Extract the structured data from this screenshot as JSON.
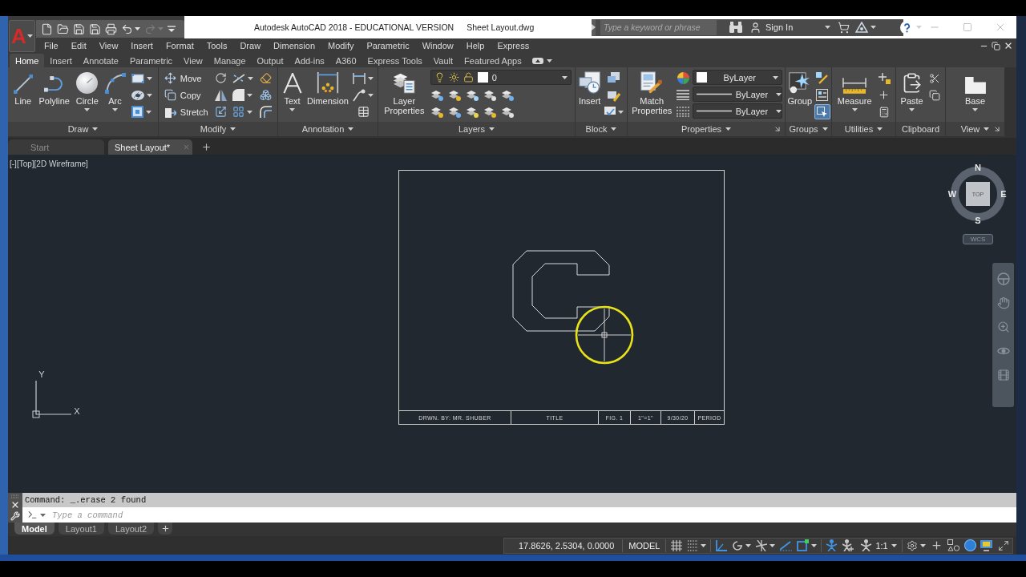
{
  "app_button": {
    "label": "A"
  },
  "quick_access": [
    {
      "kind": "new",
      "disabled": false,
      "menu": false
    },
    {
      "kind": "open",
      "disabled": false,
      "menu": false
    },
    {
      "kind": "save",
      "disabled": false,
      "menu": false
    },
    {
      "kind": "save_as",
      "disabled": false,
      "menu": false
    },
    {
      "kind": "plot",
      "disabled": false,
      "menu": false
    },
    {
      "kind": "undo",
      "disabled": false,
      "menu": true
    },
    {
      "kind": "redo",
      "disabled": true,
      "menu": true
    }
  ],
  "title": {
    "app": "Autodesk AutoCAD 2018 - EDUCATIONAL VERSION",
    "file": "Sheet Layout.dwg"
  },
  "search": {
    "placeholder": "Type a keyword or phrase"
  },
  "account": {
    "label": "Sign In"
  },
  "menu_bar": [
    "File",
    "Edit",
    "View",
    "Insert",
    "Format",
    "Tools",
    "Draw",
    "Dimension",
    "Modify",
    "Parametric",
    "Window",
    "Help",
    "Express"
  ],
  "ribbon_tabs": [
    {
      "label": "Home",
      "selected": true
    },
    {
      "label": "Insert",
      "selected": false
    },
    {
      "label": "Annotate",
      "selected": false
    },
    {
      "label": "Parametric",
      "selected": false
    },
    {
      "label": "View",
      "selected": false
    },
    {
      "label": "Manage",
      "selected": false
    },
    {
      "label": "Output",
      "selected": false
    },
    {
      "label": "Add-ins",
      "selected": false
    },
    {
      "label": "A360",
      "selected": false
    },
    {
      "label": "Express Tools",
      "selected": false
    },
    {
      "label": "Vault",
      "selected": false
    },
    {
      "label": "Featured Apps",
      "selected": false
    }
  ],
  "ribbon_panels": [
    {
      "title": "Draw",
      "menu": true,
      "launcher": false,
      "tools": [
        "Line",
        "Polyline",
        "Circle",
        "Arc"
      ]
    },
    {
      "title": "Modify",
      "menu": true,
      "launcher": false,
      "tools": [
        "Move",
        "Copy",
        "Stretch"
      ]
    },
    {
      "title": "Annotation",
      "menu": true,
      "launcher": false,
      "tools": [
        "Text",
        "Dimension"
      ]
    },
    {
      "title": "Layers",
      "menu": true,
      "launcher": false,
      "tools": [
        "Layer Properties"
      ],
      "current_layer": "0"
    },
    {
      "title": "Block",
      "menu": true,
      "launcher": false,
      "tools": [
        "Insert"
      ]
    },
    {
      "title": "Properties",
      "menu": true,
      "launcher": true,
      "tools": [
        "Match Properties"
      ],
      "object_color": "ByLayer",
      "linetype": "ByLayer",
      "lineweight": "ByLayer"
    },
    {
      "title": "Groups",
      "menu": true,
      "launcher": false,
      "tools": [
        "Group"
      ],
      "group_selection": true
    },
    {
      "title": "Utilities",
      "menu": true,
      "launcher": false,
      "tools": [
        "Measure"
      ]
    },
    {
      "title": "Clipboard",
      "menu": false,
      "launcher": false,
      "tools": [
        "Paste"
      ]
    },
    {
      "title": "View",
      "menu": true,
      "launcher": true,
      "tools": [
        "Base"
      ]
    }
  ],
  "file_tabs": [
    {
      "label": "Start",
      "selected": false,
      "closable": false
    },
    {
      "label": "Sheet Layout*",
      "selected": true,
      "closable": true
    }
  ],
  "viewport": {
    "controls": "[-][Top][2D Wireframe]"
  },
  "viewcube": {
    "north": "N",
    "east": "E",
    "south": "S",
    "west": "W",
    "face": "TOP",
    "coordinate_system": "WCS"
  },
  "ucs_icon": {
    "y_axis": "Y",
    "x_axis": "X"
  },
  "sheet": {
    "title_block": [
      "DRWN. BY: MR. SHUBER",
      "TITLE",
      "FIG. 1",
      "1\"=1\"",
      "9/30/20",
      "PERIOD"
    ]
  },
  "command_line": {
    "history": "Command: _.erase 2 found",
    "placeholder": "Type a command"
  },
  "layout_tabs": [
    {
      "label": "Model",
      "selected": true
    },
    {
      "label": "Layout1",
      "selected": false
    },
    {
      "label": "Layout2",
      "selected": false
    }
  ],
  "status_bar": {
    "coordinates": "17.8626, 2.5304, 0.0000",
    "space": "MODEL",
    "grid": [
      {
        "kind": "grid",
        "on": false,
        "menu": false
      },
      {
        "kind": "snap",
        "on": false,
        "menu": true
      }
    ],
    "drafting": [
      {
        "kind": "ortho",
        "on": true,
        "menu": false
      },
      {
        "kind": "polar",
        "on": false,
        "menu": true
      },
      {
        "kind": "isodraft",
        "on": false,
        "menu": true
      },
      {
        "kind": "tracking",
        "on": true,
        "menu": false
      },
      {
        "kind": "osnap",
        "on": true,
        "menu": true
      }
    ],
    "annotation": [
      {
        "kind": "visibility",
        "on": true,
        "menu": false
      },
      {
        "kind": "autoscale",
        "on": false,
        "menu": false
      }
    ],
    "annotation_scale": "1:1",
    "system": [
      {
        "kind": "workspace",
        "on": false,
        "menu": true
      },
      {
        "kind": "monitor",
        "on": false,
        "menu": false
      },
      {
        "kind": "quick_properties",
        "on": false,
        "menu": false
      },
      {
        "kind": "isolate",
        "on": true,
        "menu": false
      },
      {
        "kind": "hardware",
        "on": false,
        "menu": false
      },
      {
        "kind": "clean_screen",
        "on": false,
        "menu": false
      }
    ]
  }
}
